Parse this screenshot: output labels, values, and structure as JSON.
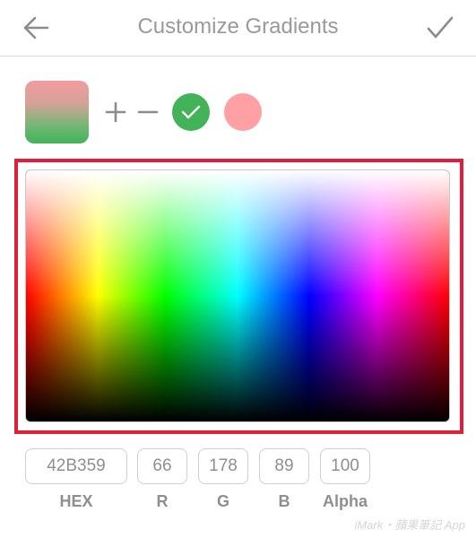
{
  "header": {
    "title": "Customize Gradients"
  },
  "gradient": {
    "colors": [
      "#42b359",
      "#ffa0a5"
    ],
    "selected": "#42b359"
  },
  "color_values": {
    "hex": {
      "value": "42B359",
      "label": "HEX"
    },
    "r": {
      "value": "66",
      "label": "R"
    },
    "g": {
      "value": "178",
      "label": "G"
    },
    "b": {
      "value": "89",
      "label": "B"
    },
    "alpha": {
      "value": "100",
      "label": "Alpha"
    }
  },
  "colors": {
    "highlight_border": "#e31d37",
    "text_gray": "#8f8f8f"
  },
  "watermark": {
    "text": "iMark・蘋果筆記 App"
  },
  "icons": [
    "arrow-left-icon",
    "checkmark-icon",
    "plus-icon",
    "minus-icon",
    "check-icon"
  ]
}
